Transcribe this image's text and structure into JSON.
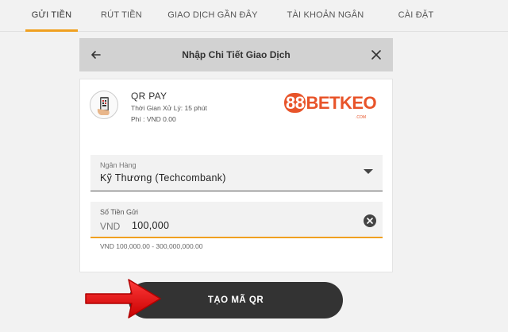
{
  "tabs": [
    {
      "label": "GỬI TIỀN",
      "active": true
    },
    {
      "label": "RÚT TIỀN",
      "active": false
    },
    {
      "label": "GIAO DỊCH GẦN ĐÂY",
      "active": false
    },
    {
      "label": "TÀI KHOẢN NGÂN HÀNG",
      "active": false
    },
    {
      "label": "CÀI ĐẶT",
      "active": false
    }
  ],
  "modal": {
    "title": "Nhập Chi Tiết Giao Dịch",
    "back_icon": "arrow-left-icon",
    "close_icon": "close-icon"
  },
  "method": {
    "name": "QR PAY",
    "processing_time": "Thời Gian Xử Lý: 15 phút",
    "fee": "Phí : VND 0.00",
    "icon": "qr-phone-icon"
  },
  "brand": {
    "logo_number": "88",
    "logo_word": "BETKEO",
    "logo_domain": ".COM",
    "color": "#e8542a"
  },
  "bank_select": {
    "label": "Ngân Hàng",
    "value": "Kỹ Thương (Techcombank)"
  },
  "amount": {
    "label": "Số Tiền Gửi",
    "currency": "VND",
    "value": "100,000",
    "hint": "VND 100,000.00 - 300,000,000.00"
  },
  "submit": {
    "label": "TẠO MÃ QR"
  },
  "colors": {
    "accent": "#f0a020",
    "button": "#333333",
    "arrow": "#e81818"
  }
}
